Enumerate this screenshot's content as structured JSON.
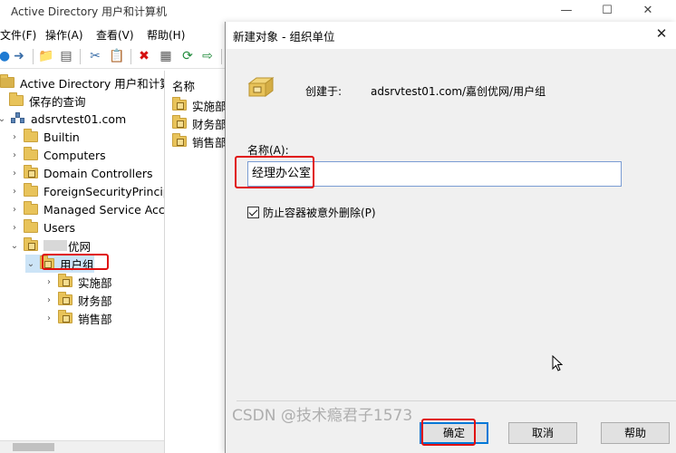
{
  "mmc": {
    "title": "Active Directory 用户和计算机",
    "menu": [
      "文件(F)",
      "操作(A)",
      "查看(V)",
      "帮助(H)"
    ],
    "list_header": "名称",
    "list_items": [
      "实施部",
      "财务部",
      "销售部"
    ],
    "tree": [
      {
        "label": "Active Directory 用户和计算机",
        "icon": "ad-console-icon"
      },
      {
        "label": "保存的查询",
        "icon": "folder-icon"
      },
      {
        "label": "adsrvtest01.com",
        "icon": "domain-icon"
      },
      {
        "label": "Builtin",
        "icon": "folder-icon"
      },
      {
        "label": "Computers",
        "icon": "folder-icon"
      },
      {
        "label": "Domain Controllers",
        "icon": "ou-folder-icon"
      },
      {
        "label": "ForeignSecurityPrincipa",
        "icon": "folder-icon"
      },
      {
        "label": "Managed Service Acco",
        "icon": "folder-icon"
      },
      {
        "label": "Users",
        "icon": "folder-icon"
      },
      {
        "label": "优网",
        "icon": "ou-folder-icon"
      },
      {
        "label": "用户组",
        "icon": "ou-folder-icon"
      },
      {
        "label": "实施部",
        "icon": "ou-folder-icon"
      },
      {
        "label": "财务部",
        "icon": "ou-folder-icon"
      },
      {
        "label": "销售部",
        "icon": "ou-folder-icon"
      }
    ]
  },
  "dialog": {
    "title": "新建对象 - 组织单位",
    "create_in_label": "创建于:",
    "create_in_path": "adsrvtest01.com/嘉创优网/用户组",
    "name_label": "名称(A):",
    "name_value": "经理办公室",
    "protect_checkbox_label": "防止容器被意外删除(P)",
    "protect_checked": true,
    "ok_label": "确定",
    "cancel_label": "取消",
    "help_label": "帮助"
  },
  "watermark": "CSDN @技术瘾君子1573",
  "colors": {
    "highlight_box": "#e01010",
    "folder": "#e8c35a",
    "focus": "#0078d7"
  }
}
